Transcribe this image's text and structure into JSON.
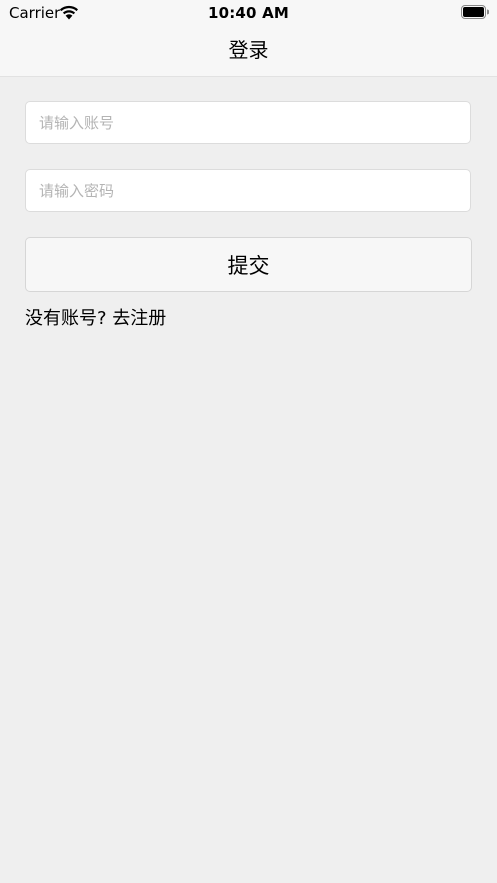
{
  "status_bar": {
    "carrier": "Carrier",
    "time": "10:40 AM",
    "wifi_icon": "wifi-icon",
    "battery_icon": "battery-icon"
  },
  "nav": {
    "title": "登录"
  },
  "form": {
    "account_placeholder": "请输入账号",
    "account_value": "",
    "password_placeholder": "请输入密码",
    "password_value": "",
    "submit_label": "提交",
    "register_text": "没有账号? 去注册"
  },
  "colors": {
    "background": "#efefef",
    "nav_background": "#f7f7f7",
    "field_background": "#ffffff",
    "placeholder": "#b4b4b4",
    "text": "#000000"
  }
}
